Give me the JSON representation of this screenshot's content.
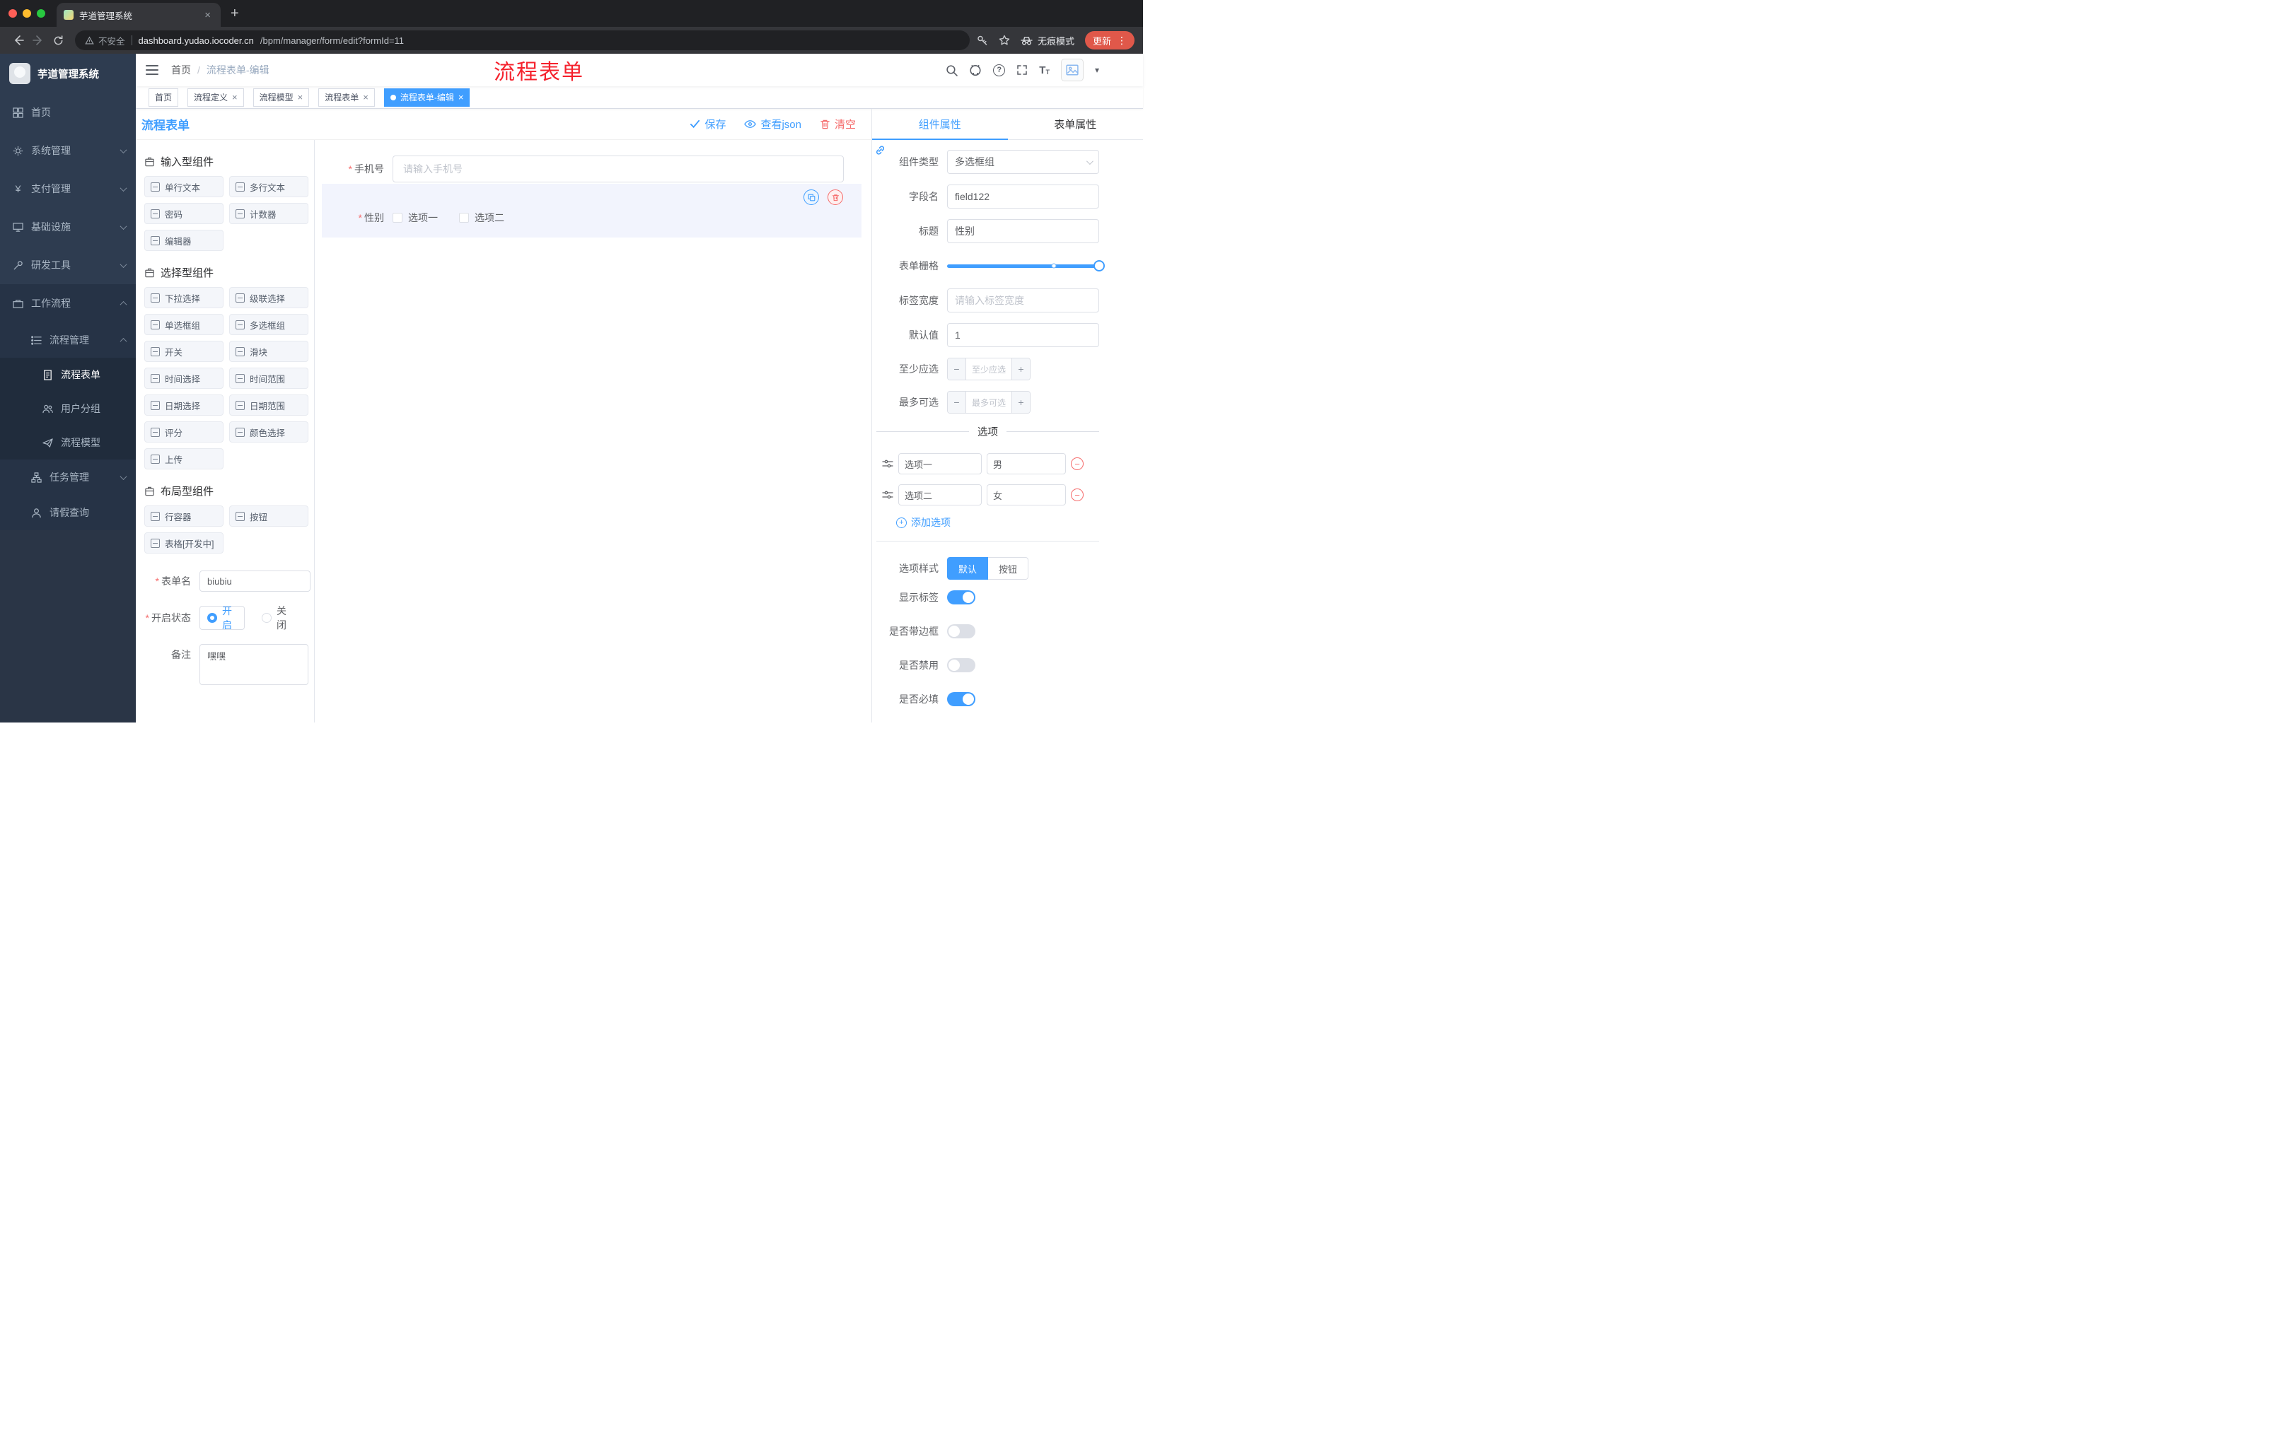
{
  "glyphs": {
    "slash": "/",
    "close": "×",
    "plus": "+",
    "minus": "−",
    "dots": "⋮",
    "caret_down": "▾",
    "question": "?",
    "yen": "¥",
    "asterisk": "*",
    "font_large": "T",
    "font_small": "T",
    "new_tab": "+"
  },
  "browser": {
    "tab_title": "芋道管理系统",
    "security_label": "不安全",
    "url_host": "dashboard.yudao.iocoder.cn",
    "url_path": "/bpm/manager/form/edit?formId=11",
    "incognito_label": "无痕模式",
    "update_label": "更新"
  },
  "sidebar": {
    "logo_title": "芋道管理系统",
    "items": [
      "首页",
      "系统管理",
      "支付管理",
      "基础设施",
      "研发工具",
      "工作流程",
      "流程管理",
      "流程表单",
      "用户分组",
      "流程模型",
      "任务管理",
      "请假查询"
    ]
  },
  "header": {
    "breadcrumb_home": "首页",
    "breadcrumb_current": "流程表单-编辑",
    "watermark": "流程表单"
  },
  "tags": [
    "首页",
    "流程定义",
    "流程模型",
    "流程表单",
    "流程表单-编辑"
  ],
  "editor": {
    "title": "流程表单",
    "save": "保存",
    "view_json": "查看json",
    "clear": "清空"
  },
  "palette": {
    "group_input": "输入型组件",
    "group_select": "选择型组件",
    "group_layout": "布局型组件",
    "input_items": [
      "单行文本",
      "多行文本",
      "密码",
      "计数器",
      "编辑器"
    ],
    "select_items": [
      "下拉选择",
      "级联选择",
      "单选框组",
      "多选框组",
      "开关",
      "滑块",
      "时间选择",
      "时间范围",
      "日期选择",
      "日期范围",
      "评分",
      "颜色选择",
      "上传"
    ],
    "layout_items": [
      "行容器",
      "按钮",
      "表格[开发中]"
    ]
  },
  "form_meta": {
    "name_label": "表单名",
    "name_value": "biubiu",
    "status_label": "开启状态",
    "status_on": "开启",
    "status_off": "关闭",
    "remark_label": "备注",
    "remark_value": "嘿嘿"
  },
  "canvas": {
    "phone_label": "手机号",
    "phone_placeholder": "请输入手机号",
    "gender_label": "性别",
    "gender_opt1": "选项一",
    "gender_opt2": "选项二"
  },
  "props": {
    "tab_component": "组件属性",
    "tab_form": "表单属性",
    "type_label": "组件类型",
    "type_value": "多选框组",
    "field_label": "字段名",
    "field_value": "field122",
    "title_label": "标题",
    "title_value": "性别",
    "grid_label": "表单栅格",
    "label_width_label": "标签宽度",
    "label_width_placeholder": "请输入标签宽度",
    "default_label": "默认值",
    "default_value": "1",
    "min_label": "至少应选",
    "min_placeholder": "至少应选",
    "max_label": "最多可选",
    "max_placeholder": "最多可选",
    "options_title": "选项",
    "options": [
      {
        "label": "选项一",
        "value": "男"
      },
      {
        "label": "选项二",
        "value": "女"
      }
    ],
    "add_option": "添加选项",
    "style_label": "选项样式",
    "style_default": "默认",
    "style_button": "按钮",
    "switch_show_label": "显示标签",
    "switch_border": "是否带边框",
    "switch_disabled": "是否禁用",
    "switch_required": "是否必填"
  }
}
